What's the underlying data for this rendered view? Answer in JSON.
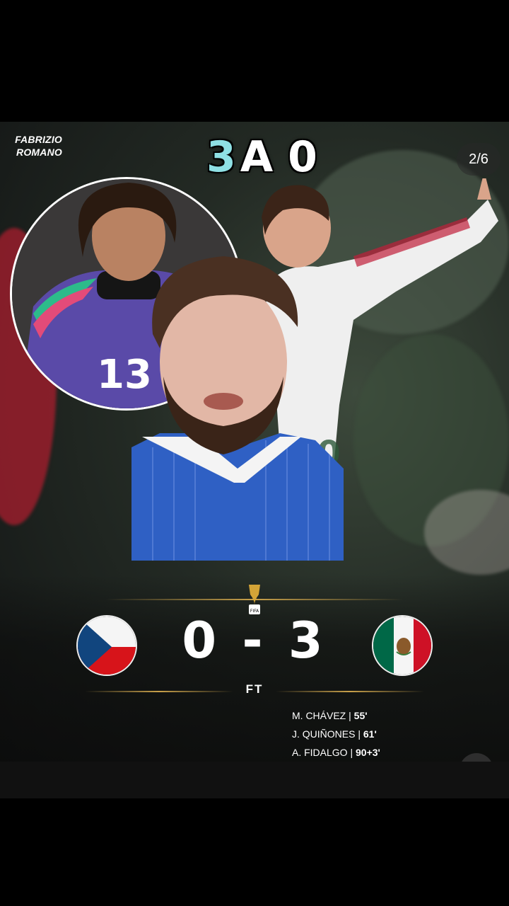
{
  "post": {
    "brand_line1": "FABRIZIO",
    "brand_line2": "ROMANO",
    "headline_digit": "3",
    "headline_rest": "A 0",
    "slide_counter": "2/6",
    "jersey_number": "13"
  },
  "match": {
    "home_team_flag": "czech-flag",
    "away_team_flag": "mexico-flag",
    "score": "0 - 3",
    "status": "FT",
    "scorers": [
      {
        "name": "M. CHÁVEZ",
        "minute": "55'"
      },
      {
        "name": "J. QUIÑONES",
        "minute": "61'"
      },
      {
        "name": "A. FIDALGO",
        "minute": "90+3'"
      }
    ]
  },
  "colors": {
    "accent_teal": "#8fe0e4",
    "gold_line": "#c9a14a",
    "czech_blue": "#11457e",
    "czech_red": "#d7141a",
    "mexico_green": "#006847",
    "mexico_red": "#ce1126"
  },
  "icons": {
    "mute": "speaker-muted-icon",
    "trophy": "world-cup-trophy-icon"
  }
}
